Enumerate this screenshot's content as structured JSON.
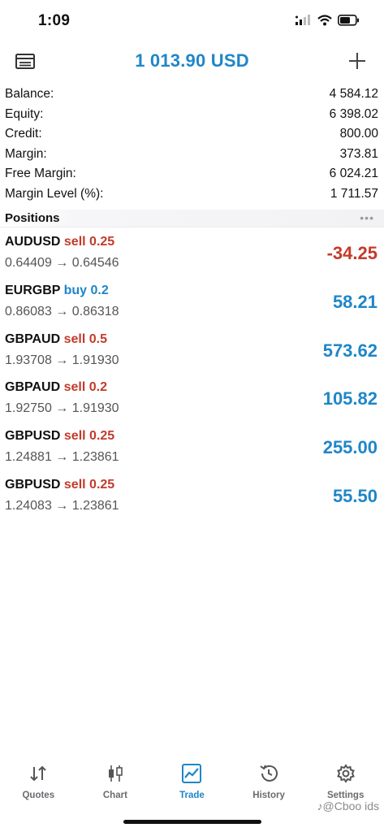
{
  "status_bar": {
    "time": "1:09"
  },
  "header": {
    "title": "1 013.90 USD",
    "left_icon": "card-icon",
    "right_icon": "plus-icon"
  },
  "summary": [
    {
      "label": "Balance:",
      "value": "4 584.12"
    },
    {
      "label": "Equity:",
      "value": "6 398.02"
    },
    {
      "label": "Credit:",
      "value": "800.00"
    },
    {
      "label": "Margin:",
      "value": "373.81"
    },
    {
      "label": "Free Margin:",
      "value": "6 024.21"
    },
    {
      "label": "Margin Level (%):",
      "value": "1 711.57"
    }
  ],
  "positions": {
    "title": "Positions",
    "more": "•••",
    "items": [
      {
        "symbol": "AUDUSD",
        "side": "sell 0.25",
        "prices": "0.64409 → 0.64546",
        "profit": "-34.25"
      },
      {
        "symbol": "EURGBP",
        "side": "buy 0.2",
        "prices": "0.86083 → 0.86318",
        "profit": "58.21"
      },
      {
        "symbol": "GBPAUD",
        "side": "sell 0.5",
        "prices": "1.93708 → 1.91930",
        "profit": "573.62"
      },
      {
        "symbol": "GBPAUD",
        "side": "sell 0.2",
        "prices": "1.92750 → 1.91930",
        "profit": "105.82"
      },
      {
        "symbol": "GBPUSD",
        "side": "sell 0.25",
        "prices": "1.24881 → 1.23861",
        "profit": "255.00"
      },
      {
        "symbol": "GBPUSD",
        "side": "sell 0.25",
        "prices": "1.24083 → 1.23861",
        "profit": "55.50"
      }
    ]
  },
  "tabs": [
    {
      "label": "Quotes",
      "icon": "quotes-icon"
    },
    {
      "label": "Chart",
      "icon": "candlestick-icon"
    },
    {
      "label": "Trade",
      "icon": "trade-icon",
      "active": true
    },
    {
      "label": "History",
      "icon": "history-icon"
    },
    {
      "label": "Settings",
      "icon": "gear-icon"
    }
  ],
  "watermark": "Cboo ids",
  "colors": {
    "accent": "#1f86c8",
    "loss": "#c43a2a"
  }
}
